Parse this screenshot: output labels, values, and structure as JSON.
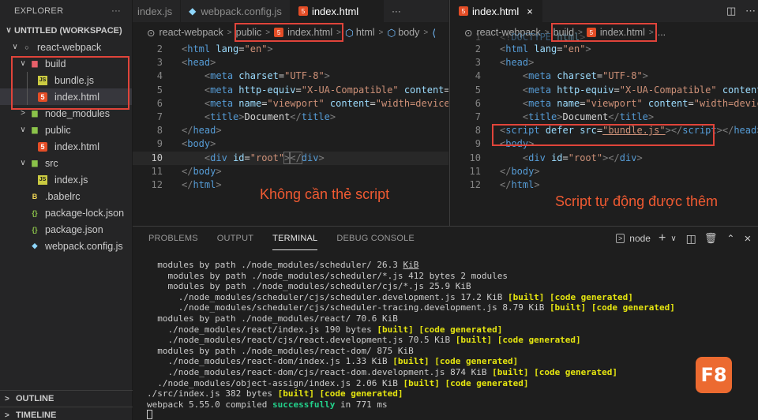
{
  "sidebar": {
    "title": "EXPLORER",
    "more": "···",
    "workspace": "UNTITLED (WORKSPACE)",
    "items": [
      {
        "label": "react-webpack",
        "depth": 1,
        "chev": "∨",
        "icon": "circle"
      },
      {
        "label": "build",
        "depth": 2,
        "chev": "∨",
        "icon": "folder-red"
      },
      {
        "label": "bundle.js",
        "depth": 3,
        "chev": "",
        "icon": "js"
      },
      {
        "label": "index.html",
        "depth": 3,
        "chev": "",
        "icon": "html",
        "selected": true
      },
      {
        "label": "node_modules",
        "depth": 2,
        "chev": ">",
        "icon": "folder-green"
      },
      {
        "label": "public",
        "depth": 2,
        "chev": "∨",
        "icon": "folder-green"
      },
      {
        "label": "index.html",
        "depth": 3,
        "chev": "",
        "icon": "html"
      },
      {
        "label": "src",
        "depth": 2,
        "chev": "∨",
        "icon": "folder-green"
      },
      {
        "label": "index.js",
        "depth": 3,
        "chev": "",
        "icon": "js"
      },
      {
        "label": ".babelrc",
        "depth": 2,
        "chev": "",
        "icon": "babel"
      },
      {
        "label": "package-lock.json",
        "depth": 2,
        "chev": "",
        "icon": "json"
      },
      {
        "label": "package.json",
        "depth": 2,
        "chev": "",
        "icon": "json"
      },
      {
        "label": "webpack.config.js",
        "depth": 2,
        "chev": "",
        "icon": "webpack"
      }
    ],
    "outline": "OUTLINE",
    "timeline": "TIMELINE"
  },
  "left_editor": {
    "tabs": [
      {
        "label": "index.js",
        "icon": "js"
      },
      {
        "label": "webpack.config.js",
        "icon": "webpack"
      },
      {
        "label": "index.html",
        "icon": "html",
        "active": true
      }
    ],
    "more": "···",
    "breadcrumb": [
      "react-webpack",
      "public",
      "index.html",
      "html",
      "body",
      "⟨"
    ],
    "annotation": "Không cần thẻ script"
  },
  "right_editor": {
    "tab": "index.html",
    "close": "×",
    "breadcrumb": [
      "react-webpack",
      "build",
      "index.html",
      "..."
    ],
    "annotation": "Script tự động được thêm"
  },
  "panel": {
    "tabs": [
      "PROBLEMS",
      "OUTPUT",
      "TERMINAL",
      "DEBUG CONSOLE"
    ],
    "active_tab": "TERMINAL",
    "shell": "node",
    "plus": "+",
    "chevron": "∨",
    "close": "×"
  },
  "logo": "F8"
}
